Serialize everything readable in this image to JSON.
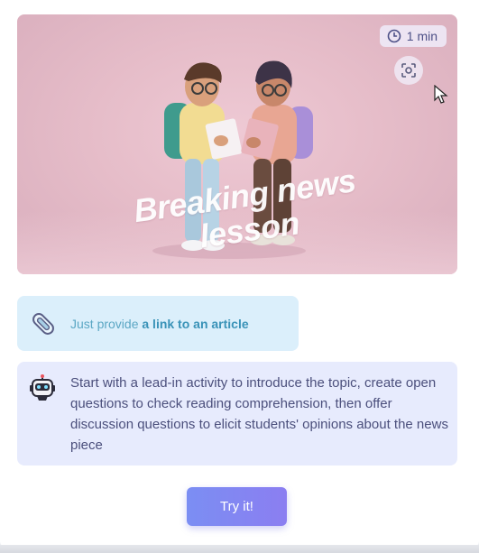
{
  "hero": {
    "title_line1": "Breaking news",
    "title_line2": "lesson",
    "duration": "1 min",
    "icons": [
      "clock-icon",
      "scan-icon"
    ]
  },
  "hint": {
    "prefix": "Just provide ",
    "link": "a link to an article",
    "icon": "paperclip-icon"
  },
  "description": {
    "text": "Start with a lead-in activity to introduce the topic, create open questions to check reading comprehension, then offer discussion questions to elicit students' opinions about the news piece",
    "icon": "robot-icon"
  },
  "cta": {
    "label": "Try it!"
  },
  "colors": {
    "accent_start": "#7b8ef3",
    "accent_end": "#8b7ef1",
    "hint_bg": "#dbeffb",
    "desc_bg": "#e7ebfd",
    "hero_bg": "#e6bdc9"
  }
}
